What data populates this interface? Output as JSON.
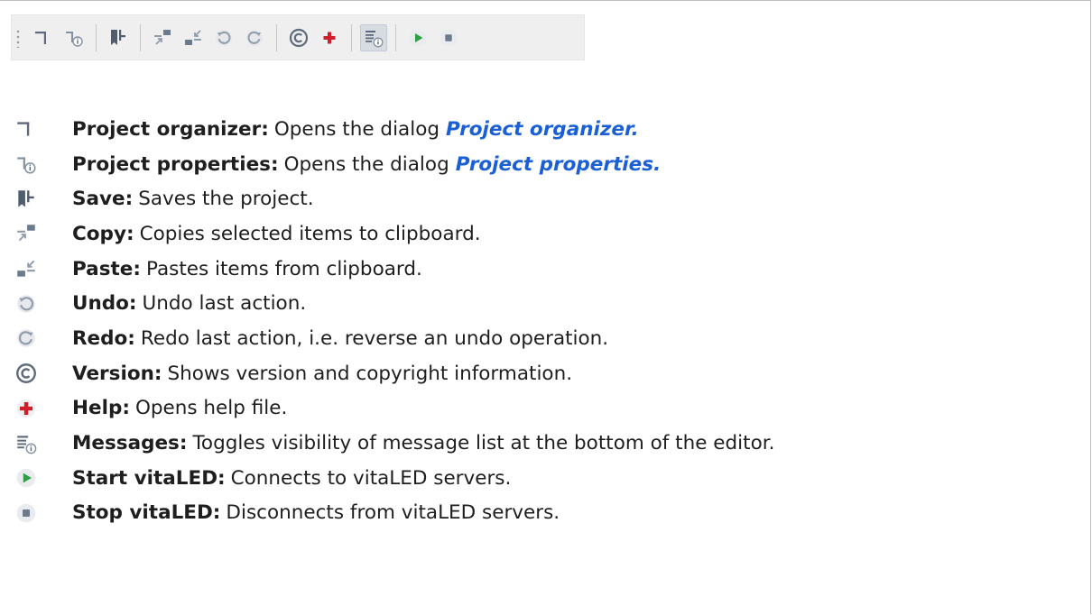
{
  "toolbar": {
    "buttons": [
      {
        "id": "project-organizer",
        "icon": "project-organizer-icon"
      },
      {
        "id": "project-properties",
        "icon": "project-properties-icon"
      },
      {
        "id": "save",
        "icon": "save-icon"
      },
      {
        "id": "copy",
        "icon": "copy-icon"
      },
      {
        "id": "paste",
        "icon": "paste-icon"
      },
      {
        "id": "undo",
        "icon": "undo-icon"
      },
      {
        "id": "redo",
        "icon": "redo-icon"
      },
      {
        "id": "version",
        "icon": "version-icon"
      },
      {
        "id": "help",
        "icon": "help-icon"
      },
      {
        "id": "messages",
        "icon": "messages-icon",
        "active": true
      },
      {
        "id": "start",
        "icon": "start-icon"
      },
      {
        "id": "stop",
        "icon": "stop-icon"
      }
    ]
  },
  "items": [
    {
      "term": "Project organizer:",
      "desc": "Opens the dialog",
      "link": "Project organizer."
    },
    {
      "term": "Project properties:",
      "desc": "Opens the dialog",
      "link": "Project properties."
    },
    {
      "term": "Save:",
      "desc": "Saves the project."
    },
    {
      "term": "Copy:",
      "desc": "Copies selected items to clipboard."
    },
    {
      "term": "Paste:",
      "desc": "Pastes items from clipboard."
    },
    {
      "term": "Undo:",
      "desc": "Undo last action."
    },
    {
      "term": "Redo:",
      "desc": "Redo last action, i.e. reverse an undo operation."
    },
    {
      "term": "Version:",
      "desc": "Shows version and copyright information."
    },
    {
      "term": "Help:",
      "desc": "Opens help file."
    },
    {
      "term": "Messages:",
      "desc": "Toggles visibility of message list at the bottom of the editor."
    },
    {
      "term": "Start vitaLED:",
      "desc": "Connects to vitaLED servers."
    },
    {
      "term": "Stop vitaLED:",
      "desc": "Disconnects from vitaLED servers."
    }
  ],
  "colors": {
    "link": "#1a5fd6",
    "icon_slate": "#5d6b7c",
    "help_red": "#d01f2a",
    "start_green": "#2ea043",
    "toolbar_bg": "#efefef"
  }
}
